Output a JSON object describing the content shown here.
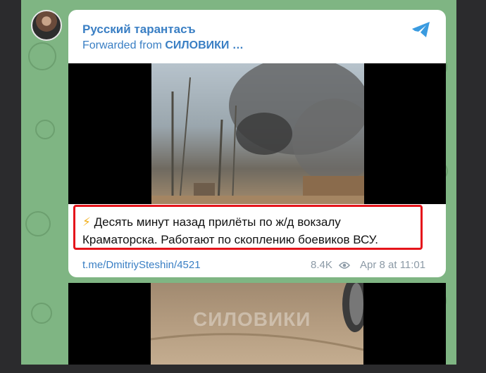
{
  "post": {
    "channel_name": "Русский тарантасъ",
    "forwarded_prefix": "Forwarded from ",
    "forwarded_source": "СИЛОВИКИ …",
    "text_emoji": "⚡",
    "text_line1": " Десять минут назад прилёты по ж/д вокзалу",
    "text_line2": "Краматорска. Работают по скоплению боевиков ВСУ.",
    "link": "t.me/DmitriySteshin/4521",
    "views": "8.4K",
    "date": "Apr 8 at 11:01"
  },
  "media": {
    "watermark": "СИЛОВИКИ"
  },
  "icons": {
    "channel": "telegram-icon",
    "views": "eye-icon"
  },
  "colors": {
    "link": "#3a7fc4",
    "highlight": "#e5141b",
    "background": "#7fb583"
  }
}
